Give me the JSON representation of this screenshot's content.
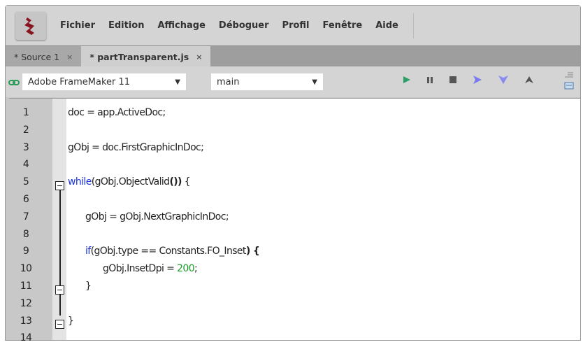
{
  "menu": [
    "Fichier",
    "Edition",
    "Affichage",
    "Déboguer",
    "Profil",
    "Fenêtre",
    "Aide"
  ],
  "tabs": [
    {
      "label": "* Source 1",
      "close": "×"
    },
    {
      "label": "* partTransparent.js",
      "close": "×"
    }
  ],
  "toolbar": {
    "target": "Adobe FrameMaker 11",
    "engine": "main"
  },
  "code": [
    {
      "n": "1",
      "indent": 0,
      "parts": [
        {
          "t": "doc = app.ActiveDoc;"
        }
      ]
    },
    {
      "n": "2",
      "indent": 0,
      "parts": []
    },
    {
      "n": "3",
      "indent": 0,
      "parts": [
        {
          "t": "gObj = doc.FirstGraphicInDoc;"
        }
      ]
    },
    {
      "n": "4",
      "indent": 0,
      "parts": []
    },
    {
      "n": "5",
      "indent": 0,
      "parts": [
        {
          "t": "while",
          "c": "kw"
        },
        {
          "t": "(gObj.ObjectValid"
        },
        {
          "t": "())",
          "c": "b"
        },
        {
          "t": " {"
        }
      ]
    },
    {
      "n": "6",
      "indent": 0,
      "parts": []
    },
    {
      "n": "7",
      "indent": 1,
      "parts": [
        {
          "t": "gObj = gObj.NextGraphicInDoc;"
        }
      ]
    },
    {
      "n": "8",
      "indent": 0,
      "parts": []
    },
    {
      "n": "9",
      "indent": 1,
      "parts": [
        {
          "t": "if",
          "c": "kw"
        },
        {
          "t": "(gObj.type == Constants.FO_Inset"
        },
        {
          "t": ") {",
          "c": "b"
        }
      ]
    },
    {
      "n": "10",
      "indent": 2,
      "parts": [
        {
          "t": "gObj.InsetDpi = "
        },
        {
          "t": "200",
          "c": "num"
        },
        {
          "t": ";"
        }
      ]
    },
    {
      "n": "11",
      "indent": 1,
      "parts": [
        {
          "t": "}"
        }
      ]
    },
    {
      "n": "12",
      "indent": 0,
      "parts": []
    },
    {
      "n": "13",
      "indent": 0,
      "parts": [
        {
          "t": "}"
        }
      ]
    },
    {
      "n": "14",
      "indent": 0,
      "parts": []
    }
  ]
}
